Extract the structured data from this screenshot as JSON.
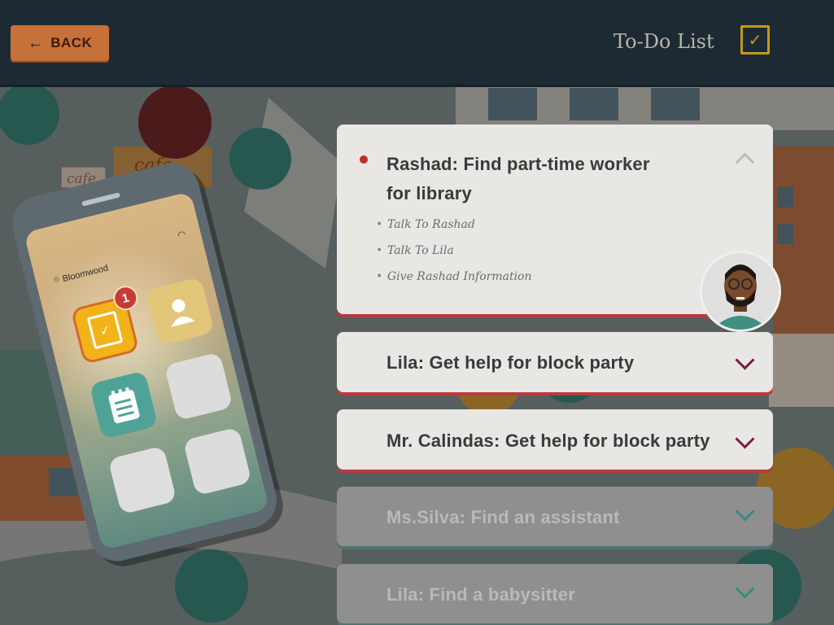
{
  "topbar": {
    "back_label": "BACK",
    "title": "To-Do List",
    "check_icon": "checkbox-icon"
  },
  "scene": {
    "sign_cafe_main": "cafe",
    "sign_cafe_small": "cafe"
  },
  "phone": {
    "location": "Bloomwood",
    "todo_badge": "1",
    "apps": [
      "todo-app",
      "contacts-app",
      "notes-app",
      "empty-app",
      "empty-app",
      "empty-app"
    ]
  },
  "tasks": [
    {
      "title_line1": "Rashad: Find part-time worker",
      "title_line2": "for library",
      "expanded": true,
      "active": true,
      "subtasks": [
        "Talk To Rashad",
        "Talk To Lila",
        "Give Rashad Information"
      ]
    },
    {
      "title": "Lila: Get help for block party",
      "expanded": false,
      "active": true
    },
    {
      "title": "Mr. Calindas: Get help for block party",
      "expanded": false,
      "active": true
    },
    {
      "title": "Ms.Silva: Find an assistant",
      "expanded": false,
      "active": false
    },
    {
      "title": "Lila: Find a babysitter",
      "expanded": false,
      "active": false
    }
  ],
  "colors": {
    "topbar": "#1d2a33",
    "back_button": "#c6703a",
    "accent_gold": "#c29a1a",
    "active_underline": "#b93b3d",
    "inactive_underline": "#4d7670",
    "chevron_active": "#7b1d45",
    "chevron_inactive": "#3b8b7f",
    "dot": "#bd2b31"
  }
}
